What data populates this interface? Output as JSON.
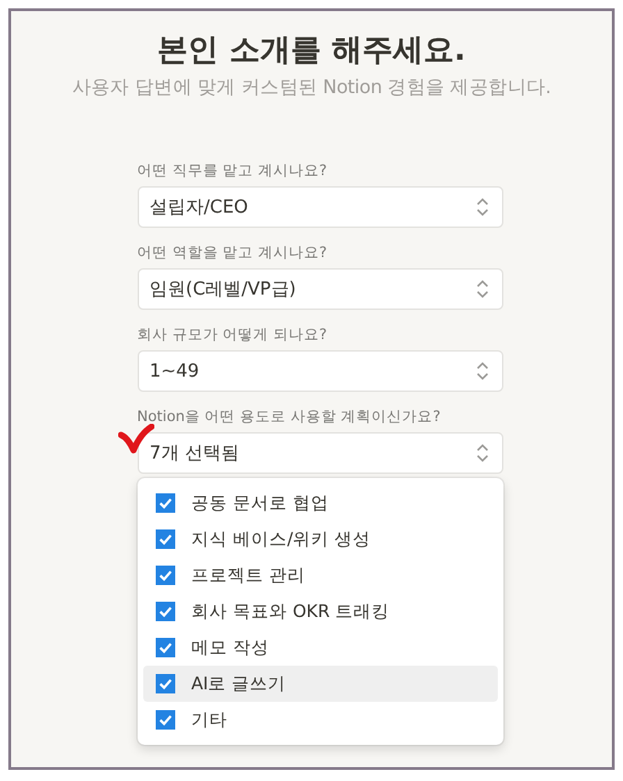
{
  "title": "본인 소개를 해주세요.",
  "subtitle": "사용자 답변에 맞게 커스텀된 Notion 경험을 제공합니다.",
  "fields": [
    {
      "label": "어떤 직무를 맡고 계시나요?",
      "value": "설립자/CEO",
      "annotated": false
    },
    {
      "label": "어떤 역할을 맡고 계시나요?",
      "value": "임원(C레벨/VP급)",
      "annotated": false
    },
    {
      "label": "회사 규모가 어떻게 되나요?",
      "value": "1~49",
      "annotated": false
    },
    {
      "label": "Notion을 어떤 용도로 사용할 계획이신가요?",
      "value": "7개 선택됨",
      "annotated": true
    }
  ],
  "options": [
    {
      "label": "공동 문서로 협업",
      "checked": true,
      "highlighted": false
    },
    {
      "label": "지식 베이스/위키 생성",
      "checked": true,
      "highlighted": false
    },
    {
      "label": "프로젝트 관리",
      "checked": true,
      "highlighted": false
    },
    {
      "label": "회사 목표와 OKR 트래킹",
      "checked": true,
      "highlighted": false
    },
    {
      "label": "메모 작성",
      "checked": true,
      "highlighted": false
    },
    {
      "label": "AI로 글쓰기",
      "checked": true,
      "highlighted": true
    },
    {
      "label": "기타",
      "checked": true,
      "highlighted": false
    }
  ]
}
